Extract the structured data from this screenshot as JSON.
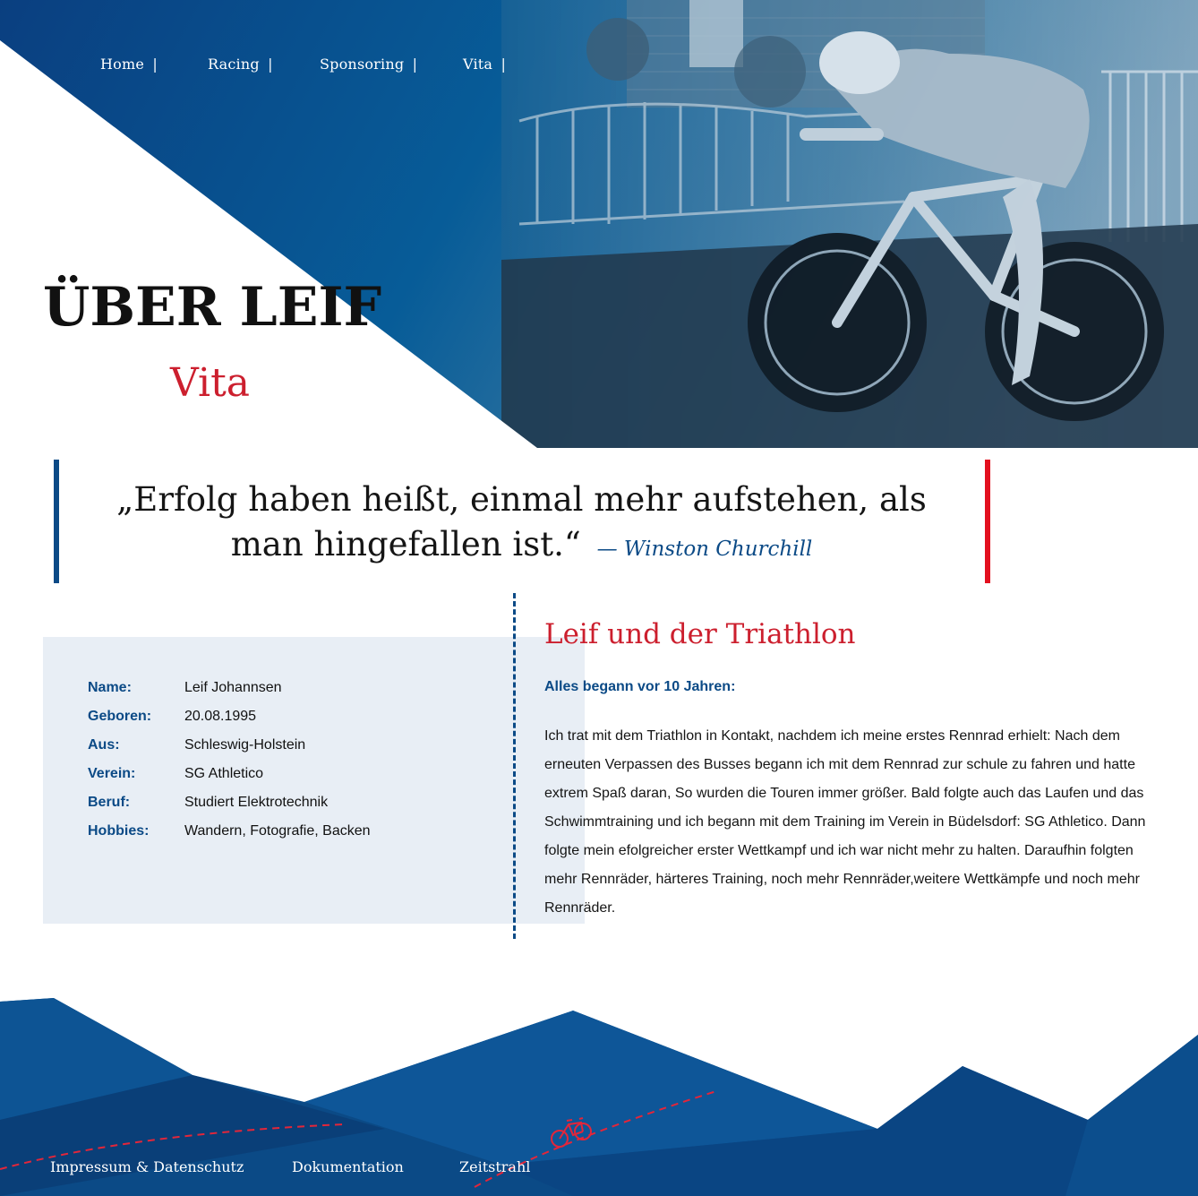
{
  "nav": {
    "items": [
      {
        "label": "Home",
        "sep": "|"
      },
      {
        "label": "Racing",
        "sep": "|"
      },
      {
        "label": "Sponsoring",
        "sep": "|"
      },
      {
        "label": "Vita",
        "sep": "|"
      }
    ]
  },
  "hero": {
    "title": "ÜBER LEIF",
    "subtitle": "Vita",
    "image": "cyclist-photo"
  },
  "quote": {
    "text": "„Erfolg haben heißt, einmal mehr aufstehen, als man hingefallen ist.“",
    "author": "— Winston Churchill"
  },
  "facts": [
    {
      "label": "Name:",
      "value": "Leif Johannsen"
    },
    {
      "label": "Geboren:",
      "value": "20.08.1995"
    },
    {
      "label": "Aus:",
      "value": "Schleswig-Holstein"
    },
    {
      "label": "Verein:",
      "value": "SG Athletico"
    },
    {
      "label": "Beruf:",
      "value": "Studiert Elektrotechnik"
    },
    {
      "label": "Hobbies:",
      "value": "Wandern, Fotografie, Backen"
    }
  ],
  "story": {
    "title": "Leif und der Triathlon",
    "lead": "Alles begann vor 10 Jahren:",
    "body": "Ich trat mit dem Triathlon in Kontakt, nachdem ich meine erstes Rennrad erhielt: Nach dem erneuten Verpassen des Busses begann ich mit dem Rennrad zur schule zu fahren und hatte extrem Spaß daran, So wurden die Touren immer größer. Bald folgte auch das Laufen und das Schwimmtraining und ich begann mit dem Training im Verein in Büdelsdorf: SG Athletico. Dann folgte mein efolgreicher erster Wettkampf und ich war nicht mehr zu halten. Daraufhin folgten mehr Rennräder, härteres Training, noch mehr Rennräder,weitere Wettkämpfe und noch mehr Rennräder."
  },
  "footer": {
    "links": [
      {
        "label": "Impressum & Datenschutz"
      },
      {
        "label": "Dokumentation"
      },
      {
        "label": "Zeitstrahl"
      }
    ],
    "icon": "bicycle-icon"
  },
  "colors": {
    "blue": "#0b4a86",
    "red": "#cc1f2e",
    "accent_red": "#e3101f",
    "panel": "#e8eef5"
  }
}
